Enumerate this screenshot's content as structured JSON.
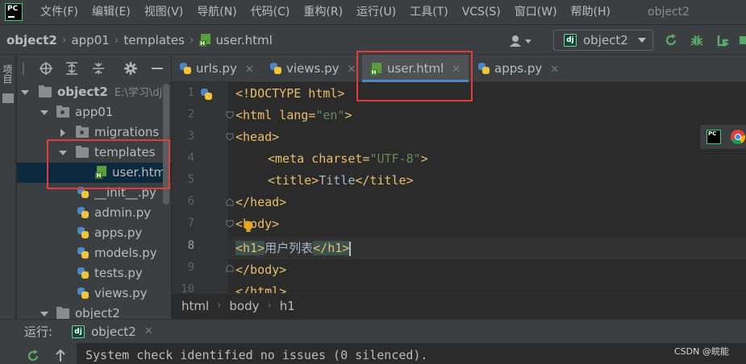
{
  "app": {
    "logo_text": "PC",
    "project_name": "object2"
  },
  "menu": [
    "文件(F)",
    "编辑(E)",
    "视图(V)",
    "导航(N)",
    "代码(C)",
    "重构(R)",
    "运行(U)",
    "工具(T)",
    "VCS(S)",
    "窗口(W)",
    "帮助(H)"
  ],
  "breadcrumbs": {
    "project": "object2",
    "module": "app01",
    "folder": "templates",
    "file": "user.html"
  },
  "run_config": {
    "icon": "dj",
    "label": "object2"
  },
  "left_strip": {
    "label": "项目"
  },
  "tree": {
    "root_name": "object2",
    "root_path": "E:\\学习\\dja",
    "app": "app01",
    "migrations": "migrations",
    "templates": "templates",
    "selected_file": "user.html",
    "files": [
      "__init__.py",
      "admin.py",
      "apps.py",
      "models.py",
      "tests.py",
      "views.py"
    ],
    "next_root": "object2"
  },
  "tabs": [
    {
      "label": "urls.py",
      "icon": "python-icon"
    },
    {
      "label": "views.py",
      "icon": "python-icon"
    },
    {
      "label": "user.html",
      "icon": "html-icon",
      "active": true
    },
    {
      "label": "apps.py",
      "icon": "python-icon"
    }
  ],
  "editor": {
    "line_numbers": [
      "1",
      "2",
      "3",
      "4",
      "5",
      "6",
      "7",
      "8",
      "9",
      "10"
    ],
    "current_line": "8",
    "lines": {
      "l1": "<!DOCTYPE html>",
      "l2_tag": "<html lang=",
      "l2_val": "\"en\"",
      "l2_end": ">",
      "l3": "<head>",
      "l4_tag": "<meta charset=",
      "l4_val": "\"UTF-8\"",
      "l4_end": ">",
      "l5_open": "<title>",
      "l5_text": "Title",
      "l5_close": "</title>",
      "l6": "</head>",
      "l7": "<body>",
      "l8_open": "<h1>",
      "l8_text": "用户列表",
      "l8_close": "</h1>",
      "l9": "</body>",
      "l10": "</html>"
    }
  },
  "editor_breadcrumbs": [
    "html",
    "body",
    "h1"
  ],
  "run_panel": {
    "title": "运行:",
    "config": "object2",
    "console": "System check identified no issues (0 silenced)."
  },
  "watermark": "CSDN @皖能",
  "colors": {
    "annotation_red": "#e03c3c",
    "active_tab_underline": "#4a88c7"
  }
}
